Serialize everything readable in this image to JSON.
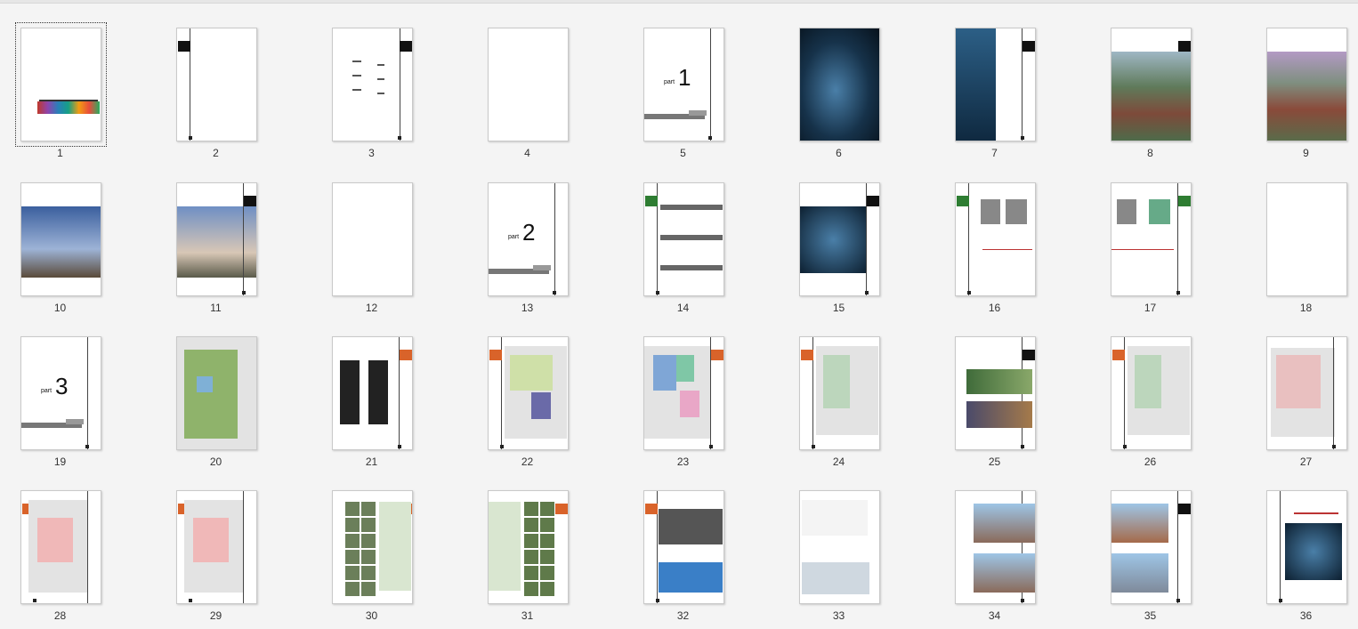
{
  "pages": [
    {
      "n": "1",
      "type": "cover",
      "selected": true
    },
    {
      "n": "2",
      "type": "blank-left-tab"
    },
    {
      "n": "3",
      "type": "toc"
    },
    {
      "n": "4",
      "type": "blank"
    },
    {
      "n": "5",
      "type": "part",
      "part_word": "part",
      "part_num": "1"
    },
    {
      "n": "6",
      "type": "photo-night"
    },
    {
      "n": "7",
      "type": "photo-tall-night"
    },
    {
      "n": "8",
      "type": "photo-aerial"
    },
    {
      "n": "9",
      "type": "photo-aerial-purple"
    },
    {
      "n": "10",
      "type": "photo-dusk"
    },
    {
      "n": "11",
      "type": "photo-dusk-right"
    },
    {
      "n": "12",
      "type": "blank"
    },
    {
      "n": "13",
      "type": "part",
      "part_word": "part",
      "part_num": "2"
    },
    {
      "n": "14",
      "type": "text-bars"
    },
    {
      "n": "15",
      "type": "photo-night-small"
    },
    {
      "n": "16",
      "type": "diagram-shapes"
    },
    {
      "n": "17",
      "type": "diagram-shapes-green"
    },
    {
      "n": "18",
      "type": "blank"
    },
    {
      "n": "19",
      "type": "part",
      "part_word": "part",
      "part_num": "3"
    },
    {
      "n": "20",
      "type": "masterplan"
    },
    {
      "n": "21",
      "type": "table-doc"
    },
    {
      "n": "22",
      "type": "plan-colored"
    },
    {
      "n": "23",
      "type": "plan-zones"
    },
    {
      "n": "24",
      "type": "plan-lines"
    },
    {
      "n": "25",
      "type": "photos-two"
    },
    {
      "n": "26",
      "type": "plan-lines"
    },
    {
      "n": "27",
      "type": "plan-red"
    },
    {
      "n": "28",
      "type": "plan-roads"
    },
    {
      "n": "29",
      "type": "plan-roads"
    },
    {
      "n": "30",
      "type": "photo-grid-left"
    },
    {
      "n": "31",
      "type": "photo-grid-right"
    },
    {
      "n": "32",
      "type": "section-blue"
    },
    {
      "n": "33",
      "type": "diagram-mixed"
    },
    {
      "n": "34",
      "type": "elevations"
    },
    {
      "n": "35",
      "type": "elevations-tall"
    },
    {
      "n": "36",
      "type": "photo-night-text"
    }
  ]
}
